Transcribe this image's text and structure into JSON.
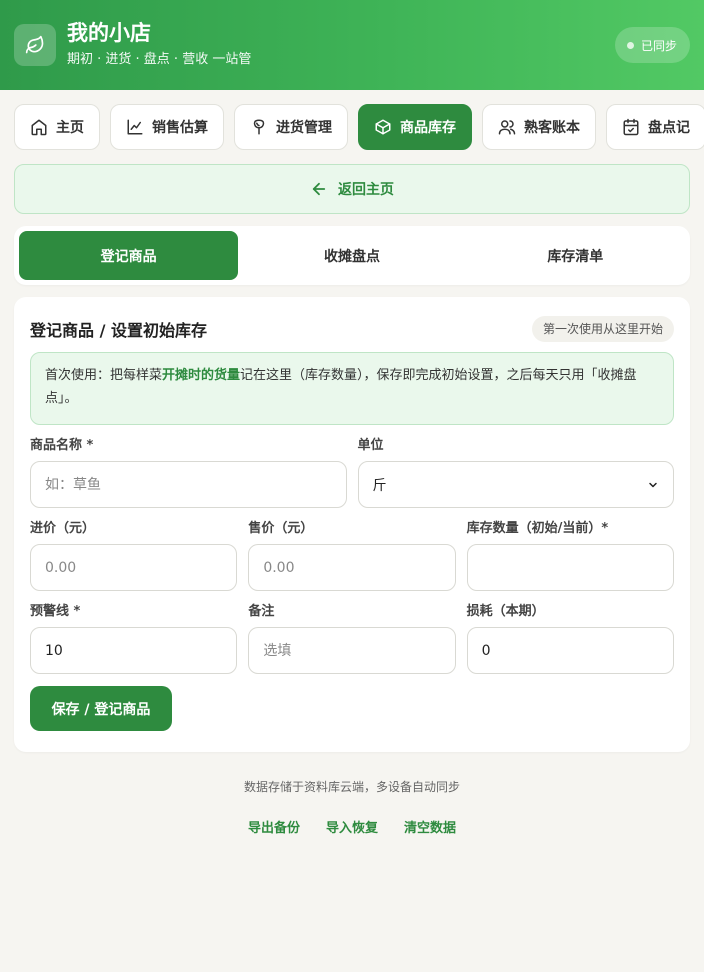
{
  "header": {
    "title": "我的小店",
    "subtitle": "期初 · 进货 · 盘点 · 营收 一站管",
    "sync_label": "已同步",
    "logo_icon": "leaf-icon"
  },
  "nav": {
    "tabs": [
      {
        "label": "主页",
        "icon": "home-icon"
      },
      {
        "label": "销售估算",
        "icon": "chart-line-icon"
      },
      {
        "label": "进货管理",
        "icon": "sprout-icon"
      },
      {
        "label": "商品库存",
        "icon": "box-icon",
        "active": true
      },
      {
        "label": "熟客账本",
        "icon": "users-icon"
      },
      {
        "label": "盘点记",
        "icon": "calendar-check-icon"
      }
    ]
  },
  "back_label": "返回主页",
  "subtabs": [
    {
      "label": "登记商品",
      "active": true
    },
    {
      "label": "收摊盘点"
    },
    {
      "label": "库存清单"
    }
  ],
  "form": {
    "title": "登记商品 / 设置初始库存",
    "hint": "第一次使用从这里开始",
    "info_pre": "首次使用：把每样菜",
    "info_strong": "开摊时的货量",
    "info_post": "记在这里（库存数量），保存即完成初始设置，之后每天只用「收摊盘点」。",
    "fields": {
      "name": {
        "label": "商品名称 *",
        "placeholder": "如：草鱼",
        "value": ""
      },
      "unit": {
        "label": "单位",
        "value": "斤"
      },
      "cost": {
        "label": "进价（元）",
        "placeholder": "0.00",
        "value": ""
      },
      "price": {
        "label": "售价（元）",
        "placeholder": "0.00",
        "value": ""
      },
      "stock": {
        "label": "库存数量（初始/当前）*",
        "placeholder": "",
        "value": ""
      },
      "alert": {
        "label": "预警线 *",
        "value": "10"
      },
      "note": {
        "label": "备注",
        "placeholder": "选填",
        "value": ""
      },
      "loss": {
        "label": "损耗（本期）",
        "value": "0"
      }
    },
    "save_label": "保存 / 登记商品"
  },
  "footer": {
    "note": "数据存储于资料库云端，多设备自动同步",
    "links": [
      "导出备份",
      "导入恢复",
      "清空数据"
    ]
  },
  "colors": {
    "primary": "#2e8b3f",
    "header_start": "#2f9a4a",
    "header_end": "#52c964",
    "info_bg": "#eaf8ec"
  }
}
